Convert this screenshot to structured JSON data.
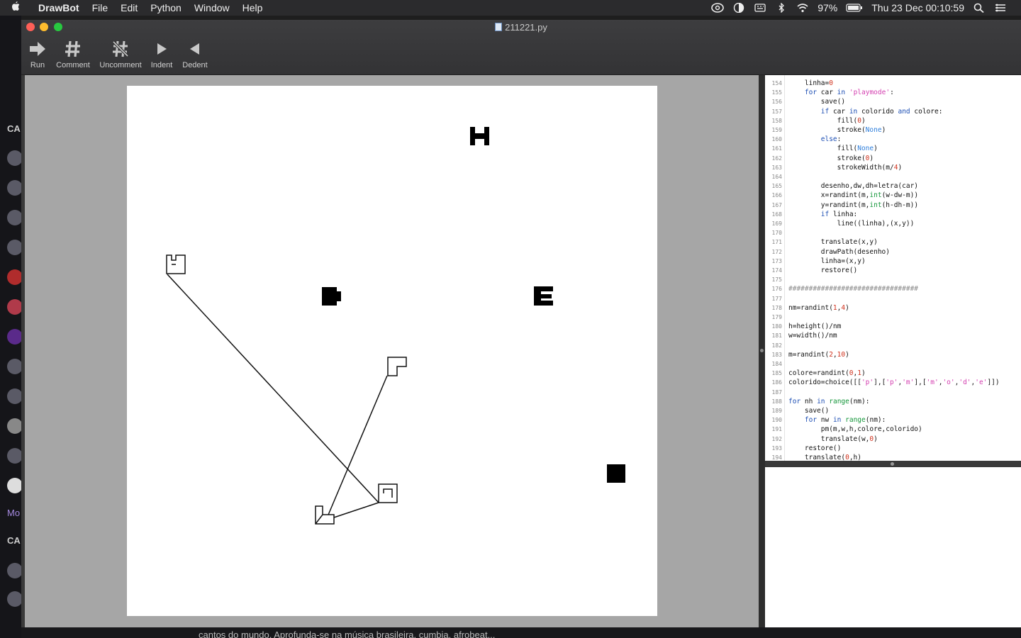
{
  "menubar": {
    "app_name": "DrawBot",
    "menus": [
      "File",
      "Edit",
      "Python",
      "Window",
      "Help"
    ],
    "battery": "97%",
    "clock": "Thu 23 Dec  00:10:59"
  },
  "background_app": {
    "section_labels": [
      "CA",
      "Mo",
      "CA"
    ],
    "bottom_text": "cantos do mundo. Aprofunda-se na música brasileira, cumbia, afrobeat..."
  },
  "window": {
    "title": "211221.py",
    "toolbar": [
      {
        "label": "Run",
        "icon": "run-arrow-icon"
      },
      {
        "label": "Comment",
        "icon": "hash-icon"
      },
      {
        "label": "Uncomment",
        "icon": "hash-slash-icon"
      },
      {
        "label": "Indent",
        "icon": "triangle-right-icon"
      },
      {
        "label": "Dedent",
        "icon": "triangle-left-icon"
      }
    ]
  },
  "colors": {
    "close": "#fe5f57",
    "minimize": "#febc2e",
    "zoom": "#28c840"
  },
  "code": {
    "lines": [
      {
        "n": "154",
        "segs": [
          [
            "    linha=",
            ""
          ],
          [
            "0",
            "num"
          ]
        ]
      },
      {
        "n": "155",
        "segs": [
          [
            "    ",
            ""
          ],
          [
            "for",
            "kw"
          ],
          [
            " car ",
            ""
          ],
          [
            "in",
            "kw"
          ],
          [
            " ",
            ""
          ],
          [
            "'playmode'",
            "str"
          ],
          [
            ":",
            ""
          ]
        ]
      },
      {
        "n": "156",
        "segs": [
          [
            "        save()",
            ""
          ]
        ]
      },
      {
        "n": "157",
        "segs": [
          [
            "        ",
            ""
          ],
          [
            "if",
            "kw"
          ],
          [
            " car ",
            ""
          ],
          [
            "in",
            "kw"
          ],
          [
            " colorido ",
            ""
          ],
          [
            "and",
            "kw"
          ],
          [
            " colore:",
            ""
          ]
        ]
      },
      {
        "n": "158",
        "segs": [
          [
            "            fill(",
            ""
          ],
          [
            "0",
            "num"
          ],
          [
            ")",
            ""
          ]
        ]
      },
      {
        "n": "159",
        "segs": [
          [
            "            stroke(",
            ""
          ],
          [
            "None",
            "none"
          ],
          [
            ")",
            ""
          ]
        ]
      },
      {
        "n": "160",
        "segs": [
          [
            "        ",
            ""
          ],
          [
            "else",
            "kw"
          ],
          [
            ":",
            ""
          ]
        ]
      },
      {
        "n": "161",
        "segs": [
          [
            "            fill(",
            ""
          ],
          [
            "None",
            "none"
          ],
          [
            ")",
            ""
          ]
        ]
      },
      {
        "n": "162",
        "segs": [
          [
            "            stroke(",
            ""
          ],
          [
            "0",
            "num"
          ],
          [
            ")",
            ""
          ]
        ]
      },
      {
        "n": "163",
        "segs": [
          [
            "            strokeWidth(m/",
            ""
          ],
          [
            "4",
            "num"
          ],
          [
            ")",
            ""
          ]
        ]
      },
      {
        "n": "164",
        "segs": [
          [
            "",
            ""
          ]
        ]
      },
      {
        "n": "165",
        "segs": [
          [
            "        desenho,dw,dh=letra(car)",
            ""
          ]
        ]
      },
      {
        "n": "166",
        "segs": [
          [
            "        x=randint(m,",
            ""
          ],
          [
            "int",
            "bi"
          ],
          [
            "(w-dw-m))",
            ""
          ]
        ]
      },
      {
        "n": "167",
        "segs": [
          [
            "        y=randint(m,",
            ""
          ],
          [
            "int",
            "bi"
          ],
          [
            "(h-dh-m))",
            ""
          ]
        ]
      },
      {
        "n": "168",
        "segs": [
          [
            "        ",
            ""
          ],
          [
            "if",
            "kw"
          ],
          [
            " linha:",
            ""
          ]
        ]
      },
      {
        "n": "169",
        "segs": [
          [
            "            line((linha),(x,y))",
            ""
          ]
        ]
      },
      {
        "n": "170",
        "segs": [
          [
            "",
            ""
          ]
        ]
      },
      {
        "n": "171",
        "segs": [
          [
            "        translate(x,y)",
            ""
          ]
        ]
      },
      {
        "n": "172",
        "segs": [
          [
            "        drawPath(desenho)",
            ""
          ]
        ]
      },
      {
        "n": "173",
        "segs": [
          [
            "        linha=(x,y)",
            ""
          ]
        ]
      },
      {
        "n": "174",
        "segs": [
          [
            "        restore()",
            ""
          ]
        ]
      },
      {
        "n": "175",
        "segs": [
          [
            "",
            ""
          ]
        ]
      },
      {
        "n": "176",
        "segs": [
          [
            "################################",
            "cmt"
          ]
        ]
      },
      {
        "n": "177",
        "segs": [
          [
            "",
            ""
          ]
        ]
      },
      {
        "n": "178",
        "segs": [
          [
            "nm=randint(",
            ""
          ],
          [
            "1",
            "num"
          ],
          [
            ",",
            ""
          ],
          [
            "4",
            "num"
          ],
          [
            ")",
            ""
          ]
        ]
      },
      {
        "n": "179",
        "segs": [
          [
            "",
            ""
          ]
        ]
      },
      {
        "n": "180",
        "segs": [
          [
            "h=height()/nm",
            ""
          ]
        ]
      },
      {
        "n": "181",
        "segs": [
          [
            "w=width()/nm",
            ""
          ]
        ]
      },
      {
        "n": "182",
        "segs": [
          [
            "",
            ""
          ]
        ]
      },
      {
        "n": "183",
        "segs": [
          [
            "m=randint(",
            ""
          ],
          [
            "2",
            "num"
          ],
          [
            ",",
            ""
          ],
          [
            "10",
            "num"
          ],
          [
            ")",
            ""
          ]
        ]
      },
      {
        "n": "184",
        "segs": [
          [
            "",
            ""
          ]
        ]
      },
      {
        "n": "185",
        "segs": [
          [
            "colore=randint(",
            ""
          ],
          [
            "0",
            "num"
          ],
          [
            ",",
            ""
          ],
          [
            "1",
            "num"
          ],
          [
            ")",
            ""
          ]
        ]
      },
      {
        "n": "186",
        "segs": [
          [
            "colorido=choice([[",
            ""
          ],
          [
            "'p'",
            "str"
          ],
          [
            "],[",
            ""
          ],
          [
            "'p'",
            "str"
          ],
          [
            ",",
            ""
          ],
          [
            "'m'",
            "str"
          ],
          [
            "],[",
            ""
          ],
          [
            "'m'",
            "str"
          ],
          [
            ",",
            ""
          ],
          [
            "'o'",
            "str"
          ],
          [
            ",",
            ""
          ],
          [
            "'d'",
            "str"
          ],
          [
            ",",
            ""
          ],
          [
            "'e'",
            "str"
          ],
          [
            "]])",
            ""
          ]
        ]
      },
      {
        "n": "187",
        "segs": [
          [
            "",
            ""
          ]
        ]
      },
      {
        "n": "188",
        "segs": [
          [
            "for",
            "kw"
          ],
          [
            " nh ",
            ""
          ],
          [
            "in",
            "kw"
          ],
          [
            " ",
            ""
          ],
          [
            "range",
            "bi"
          ],
          [
            "(nm):",
            ""
          ]
        ]
      },
      {
        "n": "189",
        "segs": [
          [
            "    save()",
            ""
          ]
        ]
      },
      {
        "n": "190",
        "segs": [
          [
            "    ",
            ""
          ],
          [
            "for",
            "kw"
          ],
          [
            " nw ",
            ""
          ],
          [
            "in",
            "kw"
          ],
          [
            " ",
            ""
          ],
          [
            "range",
            "bi"
          ],
          [
            "(nm):",
            ""
          ]
        ]
      },
      {
        "n": "191",
        "segs": [
          [
            "        pm(m,w,h,colore,colorido)",
            ""
          ]
        ]
      },
      {
        "n": "192",
        "segs": [
          [
            "        translate(w,",
            ""
          ],
          [
            "0",
            "num"
          ],
          [
            ")",
            ""
          ]
        ]
      },
      {
        "n": "193",
        "segs": [
          [
            "    restore()",
            ""
          ]
        ]
      },
      {
        "n": "194",
        "segs": [
          [
            "    translate(",
            ""
          ],
          [
            "0",
            "num"
          ],
          [
            ",h)",
            ""
          ]
        ]
      }
    ]
  }
}
